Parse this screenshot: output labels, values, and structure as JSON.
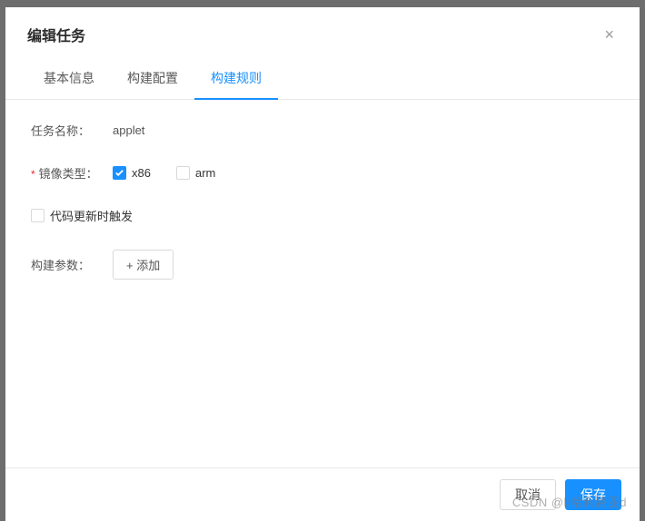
{
  "modal": {
    "title": "编辑任务"
  },
  "tabs": [
    {
      "label": "基本信息",
      "active": false
    },
    {
      "label": "构建配置",
      "active": false
    },
    {
      "label": "构建规则",
      "active": true
    }
  ],
  "form": {
    "task_name_label": "任务名称：",
    "task_name_value": "applet",
    "image_type_label": "镜像类型：",
    "image_type_options": {
      "x86": {
        "label": "x86",
        "checked": true
      },
      "arm": {
        "label": "arm",
        "checked": false
      }
    },
    "code_update_trigger_label": "代码更新时触发",
    "code_update_trigger_checked": false,
    "build_params_label": "构建参数：",
    "add_button_label": "+ 添加"
  },
  "footer": {
    "cancel_label": "取消",
    "save_label": "保存"
  },
  "watermark": "CSDN @b哈利路亚d"
}
